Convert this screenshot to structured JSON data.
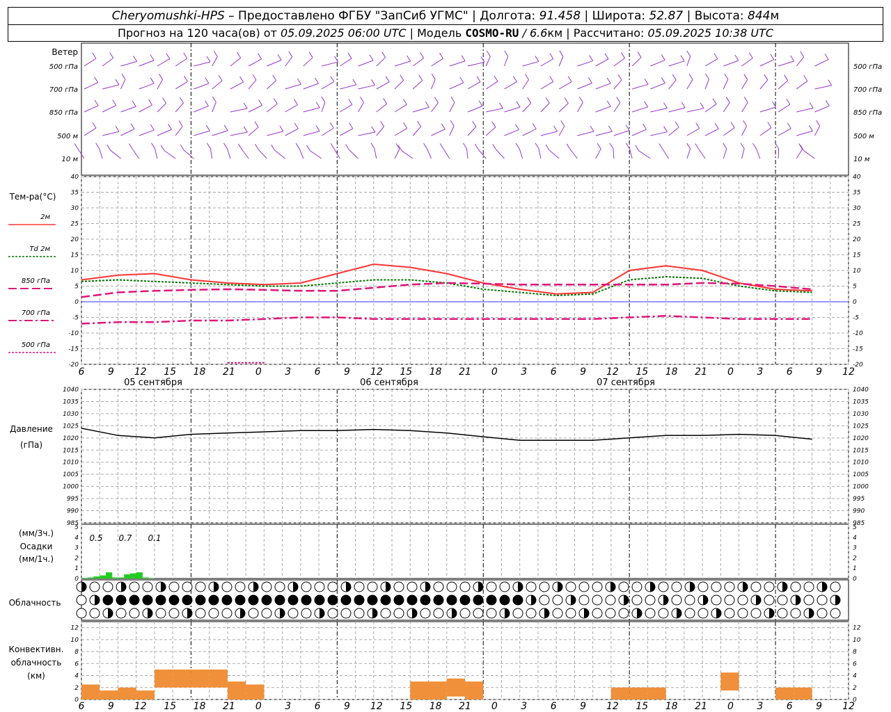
{
  "header": {
    "station": "Cheryomushki-HPS",
    "sep1": " – Предоставлено ФГБУ \"ЗапСиб УГМС\" | Долгота: ",
    "lon": "91.458",
    "sep2": " | Широта: ",
    "lat": "52.87",
    "sep3": " | Высота: ",
    "alt": "844",
    "alt_unit": "м",
    "forecast_prefix": "Прогноз на 120 часа(ов) от ",
    "forecast_start": "05.09.2025 06:00 UTC",
    "model_prefix": " | Модель ",
    "model_name": "COSMO-RU",
    "model_res": " / 6.6",
    "model_res_unit": "км",
    "calc_prefix": " | Рассчитано: ",
    "calc_time": "05.09.2025 10:38 UTC"
  },
  "time_axis": {
    "hour_labels": [
      "6",
      "9",
      "12",
      "15",
      "18",
      "21",
      "0",
      "3",
      "6",
      "9",
      "12",
      "15",
      "18",
      "21",
      "0",
      "3",
      "6",
      "9",
      "12",
      "15",
      "18",
      "21",
      "0",
      "3",
      "6",
      "9",
      "12"
    ],
    "dates": [
      "05 сентября",
      "06 сентября",
      "07 сентября"
    ]
  },
  "wind_panel": {
    "title": "Ветер",
    "levels": [
      "500 гПа",
      "700 гПа",
      "850 гПа",
      "500 м",
      "10 м"
    ],
    "barb_color": "#9933cc"
  },
  "temperature_panel": {
    "title": "Тем-ра(°C)",
    "legend": [
      "2м",
      "Td 2м",
      "850 гПа",
      "700 гПа",
      "500 гПа"
    ],
    "ticks": [
      "40",
      "35",
      "30",
      "25",
      "20",
      "15",
      "10",
      "5",
      "0",
      "-5",
      "-10",
      "-15",
      "-20"
    ]
  },
  "pressure_panel": {
    "title": "Давление",
    "unit": "(гПа)",
    "ticks": [
      "1040",
      "1035",
      "1030",
      "1025",
      "1020",
      "1015",
      "1010",
      "1005",
      "1000",
      "995",
      "990",
      "985"
    ]
  },
  "precip_panel": {
    "label_top": "(мм/3ч.)",
    "label_mid": "Осадки",
    "label_bot": "(мм/1ч.)",
    "ticks": [
      "5",
      "4",
      "3",
      "2",
      "1",
      "0"
    ],
    "totals": [
      "0.5",
      "0.7",
      "0.1"
    ]
  },
  "cloud_panel": {
    "title": "Облачность"
  },
  "convective_panel": {
    "title_l1": "Конвективн.",
    "title_l2": "облачность",
    "title_l3": "(км)",
    "ticks": [
      "12",
      "10",
      "8",
      "6",
      "4",
      "2",
      "0"
    ]
  },
  "colors": {
    "t2m": "#ff3333",
    "td2m": "#007700",
    "t850": "#e0157a",
    "t700": "#e0157a",
    "t500": "#e0157a",
    "pressure": "#000000",
    "precip": "#22cc22",
    "convective": "#f0903a",
    "zero_line": "#3333ff"
  },
  "chart_data": [
    {
      "type": "line",
      "title": "Тем-ра(°C)",
      "ylim": [
        -20,
        40
      ],
      "x_hours": [
        0,
        6,
        12,
        18,
        24,
        30,
        36,
        42,
        48,
        54,
        60,
        66,
        72,
        78,
        84,
        90,
        96,
        102,
        108,
        114,
        120
      ],
      "series": [
        {
          "name": "2м",
          "values": [
            7,
            8.5,
            9,
            7,
            6,
            5.5,
            6,
            9,
            12,
            11,
            9,
            6,
            4,
            2.5,
            3,
            10,
            11.5,
            10,
            6,
            4,
            3.5
          ]
        },
        {
          "name": "Td 2м",
          "values": [
            6.5,
            7,
            6.5,
            6,
            5.5,
            5,
            5,
            6,
            7,
            7,
            6,
            4,
            3,
            2,
            2.5,
            7,
            8,
            7.5,
            5,
            3.5,
            3
          ]
        },
        {
          "name": "850 гПа",
          "values": [
            1.5,
            3,
            3.5,
            3.8,
            4,
            3.8,
            3.5,
            3.5,
            4.5,
            5.5,
            6,
            5.8,
            5.5,
            5.5,
            5.5,
            5.5,
            5.5,
            6,
            5.8,
            5,
            4
          ]
        },
        {
          "name": "700 гПа",
          "values": [
            -7,
            -6.5,
            -6.5,
            -6,
            -6,
            -5.5,
            -5,
            -5,
            -5.5,
            -5.5,
            -5.5,
            -5.5,
            -5.5,
            -5.5,
            -5.5,
            -5,
            -4.5,
            -5,
            -5.5,
            -5.5,
            -5.5
          ]
        },
        {
          "name": "500 гПа",
          "values": [
            null,
            null,
            null,
            null,
            -19.5,
            -19.5,
            null,
            null,
            null,
            null,
            null,
            null,
            null,
            null,
            null,
            null,
            null,
            null,
            null,
            null,
            null
          ]
        }
      ]
    },
    {
      "type": "line",
      "title": "Давление",
      "ylim": [
        985,
        1040
      ],
      "x_hours": [
        0,
        6,
        12,
        18,
        24,
        30,
        36,
        42,
        48,
        54,
        60,
        66,
        72,
        78,
        84,
        90,
        96,
        102,
        108,
        114,
        120
      ],
      "series": [
        {
          "name": "Давление",
          "values": [
            1024,
            1021,
            1020,
            1021.5,
            1022,
            1022.5,
            1023,
            1023,
            1023.5,
            1023,
            1022,
            1020.5,
            1019,
            1019,
            1019,
            1020,
            1021,
            1021,
            1021.5,
            1021,
            1019.5
          ]
        }
      ]
    },
    {
      "type": "bar",
      "title": "Осадки",
      "ylim": [
        0,
        5
      ],
      "x_hours": [
        0,
        1,
        2,
        3,
        4,
        5,
        6,
        7,
        8,
        9,
        10,
        11
      ],
      "values": [
        0.05,
        0.1,
        0.2,
        0.3,
        0.6,
        0.1,
        0.1,
        0.4,
        0.5,
        0.6,
        0.1,
        0.05
      ]
    },
    {
      "type": "bar",
      "title": "Конвективн. облачность",
      "ylim": [
        0,
        13
      ],
      "x_hours": [
        0,
        3,
        6,
        9,
        12,
        15,
        18,
        21,
        24,
        27,
        30,
        33,
        36,
        39,
        42,
        45,
        48,
        51,
        54,
        57,
        60,
        63,
        66,
        69,
        72,
        75,
        78,
        81,
        84,
        87,
        90,
        93,
        96,
        99,
        102,
        105,
        108,
        111,
        114,
        117
      ],
      "values": [
        2.5,
        1.5,
        2,
        1.5,
        5,
        5,
        5,
        5,
        3,
        2.5,
        0,
        0,
        0,
        0,
        0,
        0,
        0,
        0,
        3,
        3,
        3.5,
        3,
        0,
        0,
        0,
        0,
        0,
        0,
        0,
        2,
        2,
        2,
        0,
        0,
        0,
        4.5,
        0,
        0,
        2,
        2
      ]
    }
  ]
}
